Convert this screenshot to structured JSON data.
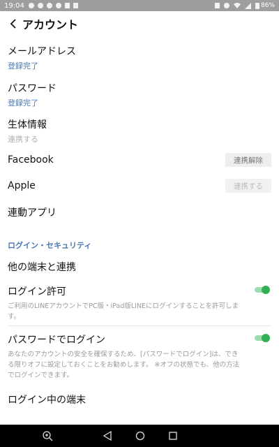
{
  "status_bar": {
    "time": "19:04",
    "battery": "86%"
  },
  "header": {
    "title": "アカウント"
  },
  "items": {
    "email": {
      "label": "メールアドレス",
      "status": "登録完了"
    },
    "password": {
      "label": "パスワード",
      "status": "登録完了"
    },
    "biometric": {
      "label": "生体情報",
      "status": "連携する"
    },
    "facebook": {
      "label": "Facebook",
      "button": "連携解除"
    },
    "apple": {
      "label": "Apple",
      "button": "連携する"
    },
    "linked_apps": {
      "label": "連動アプリ"
    }
  },
  "security": {
    "section_title": "ログイン・セキュリティ",
    "other_devices": {
      "label": "他の端末と連携"
    },
    "login_allow": {
      "label": "ログイン許可",
      "description": "ご利用のLINEアカウントでPC版・iPad版LINEにログインすることを許可します。",
      "enabled": true
    },
    "password_login": {
      "label": "パスワードでログイン",
      "description": "あなたのアカウントの安全を確保するため、[パスワードでログイン]は、できる限りオフに設定しておくことをお勧めします。 ※オフの状態でも、他の方法でログインできます。",
      "enabled": true
    },
    "logged_in_devices": {
      "label": "ログイン中の端末"
    }
  },
  "colors": {
    "accent_blue": "#4a78b5",
    "toggle_green": "#2fb052",
    "status_bar_bg": "#9e9e9e",
    "nav_bar_bg": "#000000"
  },
  "icons": {
    "back": "chevron-left-icon",
    "nav": [
      "zoom-icon",
      "back-triangle-icon",
      "home-circle-icon",
      "recents-square-icon"
    ]
  }
}
